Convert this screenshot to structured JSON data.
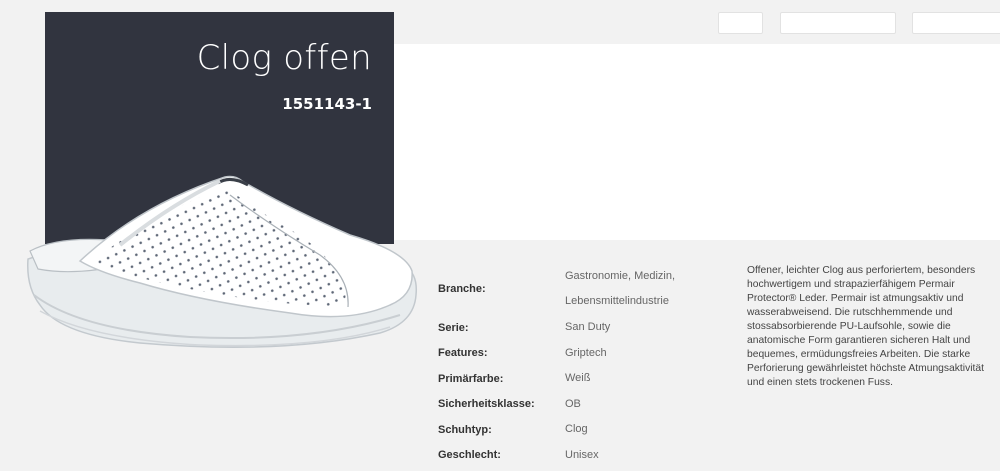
{
  "product": {
    "title": "Clog offen",
    "sku": "1551143-1"
  },
  "specs": [
    {
      "key": "Branche:",
      "value": "Gastronomie, Medizin,\nLebensmittelindustrie"
    },
    {
      "key": "Serie:",
      "value": "San Duty"
    },
    {
      "key": "Features:",
      "value": "Griptech"
    },
    {
      "key": "Primärfarbe:",
      "value": "Weiß"
    },
    {
      "key": "Sicherheitsklasse:",
      "value": "OB"
    },
    {
      "key": "Schuhtyp:",
      "value": "Clog"
    },
    {
      "key": "Geschlecht:",
      "value": "Unisex"
    }
  ],
  "description": "Offener, leichter Clog aus perforiertem, besonders hochwertigem und strapazierfähigem Permair Protector® Leder. Permair ist atmungsaktiv und wasserabweisend. Die rutschhemmende und stossabsorbierende PU-Laufsohle, sowie die anatomische Form garantieren sicheren Halt und bequemes, ermüdungsfreies Arbeiten. Die starke Perforierung gewährleistet höchste Atmungsaktivität und einen stets trockenen Fuss.",
  "colors": {
    "panel": "#31343f",
    "background": "#f2f2f2"
  },
  "icons": {
    "product_image": "white-perforated-clog"
  }
}
